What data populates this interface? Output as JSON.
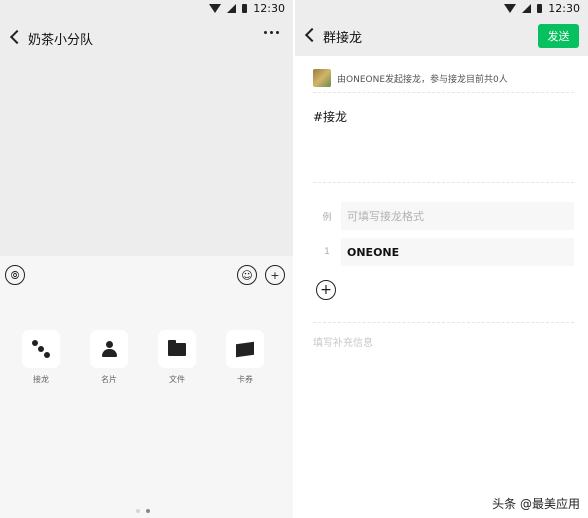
{
  "status_bar": {
    "time": "12:30"
  },
  "left_screen": {
    "title": "奶茶小分队",
    "tools": [
      {
        "label": "接龙",
        "icon": "jielong-icon"
      },
      {
        "label": "名片",
        "icon": "contact-card-icon"
      },
      {
        "label": "文件",
        "icon": "folder-icon"
      },
      {
        "label": "卡券",
        "icon": "coupon-icon"
      }
    ],
    "page_indicator": {
      "pages": 2,
      "current": 2
    }
  },
  "right_screen": {
    "title": "群接龙",
    "send_label": "发送",
    "header_text": "由ONEONE发起接龙，参与接龙目前共0人",
    "topic": "#接龙",
    "example_row": {
      "index": "例",
      "placeholder": "可填写接龙格式"
    },
    "entry_row": {
      "index": "1",
      "value": "ONEONE"
    },
    "note_placeholder": "填写补充信息"
  },
  "watermark": "头条 @最美应用",
  "colors": {
    "send_button": "#07c160",
    "chat_bg": "#ededed",
    "panel_bg": "#f6f6f6"
  }
}
